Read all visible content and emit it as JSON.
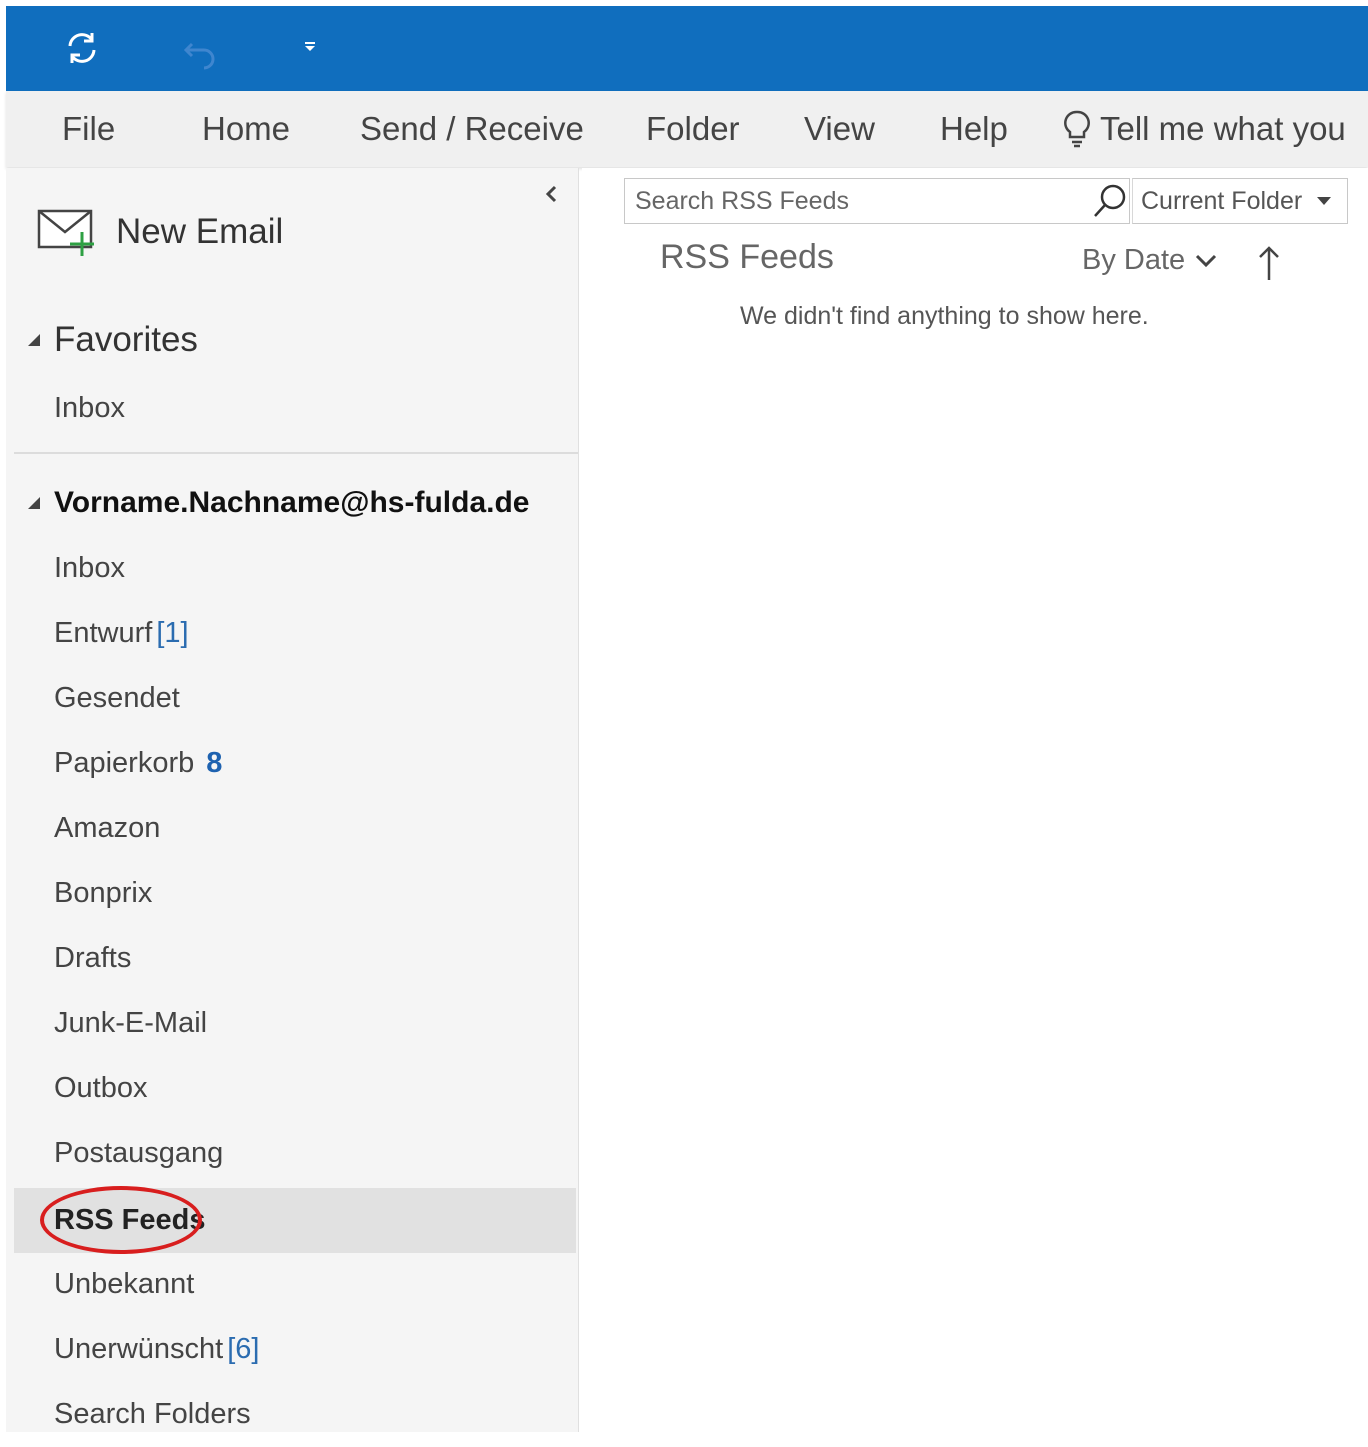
{
  "titlebar": {
    "sync_icon": "sync-icon",
    "undo_icon": "undo-icon",
    "qat_icon": "customize-quick-access-icon",
    "color": "#106ebe"
  },
  "menu": {
    "items": [
      "File",
      "Home",
      "Send / Receive",
      "Folder",
      "View",
      "Help"
    ],
    "tell_me": "Tell me what you"
  },
  "sidebar": {
    "new_email": "New Email",
    "favorites": {
      "label": "Favorites",
      "items": [
        {
          "label": "Inbox"
        }
      ]
    },
    "account": {
      "label": "Vorname.Nachname@hs-fulda.de",
      "folders": [
        {
          "label": "Inbox"
        },
        {
          "label": "Entwurf",
          "count": "[1]"
        },
        {
          "label": "Gesendet"
        },
        {
          "label": "Papierkorb",
          "count": "8"
        },
        {
          "label": "Amazon"
        },
        {
          "label": "Bonprix"
        },
        {
          "label": "Drafts"
        },
        {
          "label": "Junk-E-Mail"
        },
        {
          "label": "Outbox"
        },
        {
          "label": "Postausgang"
        },
        {
          "label": "RSS Feeds",
          "selected": true
        },
        {
          "label": "Unbekannt"
        },
        {
          "label": "Unerwünscht",
          "count": "[6]"
        },
        {
          "label": "Search Folders"
        }
      ]
    },
    "highlight_color": "#d81e1e"
  },
  "main": {
    "search_placeholder": "Search RSS Feeds",
    "scope": "Current Folder",
    "title": "RSS Feeds",
    "sort": "By Date",
    "empty_message": "We didn't find anything to show here."
  }
}
